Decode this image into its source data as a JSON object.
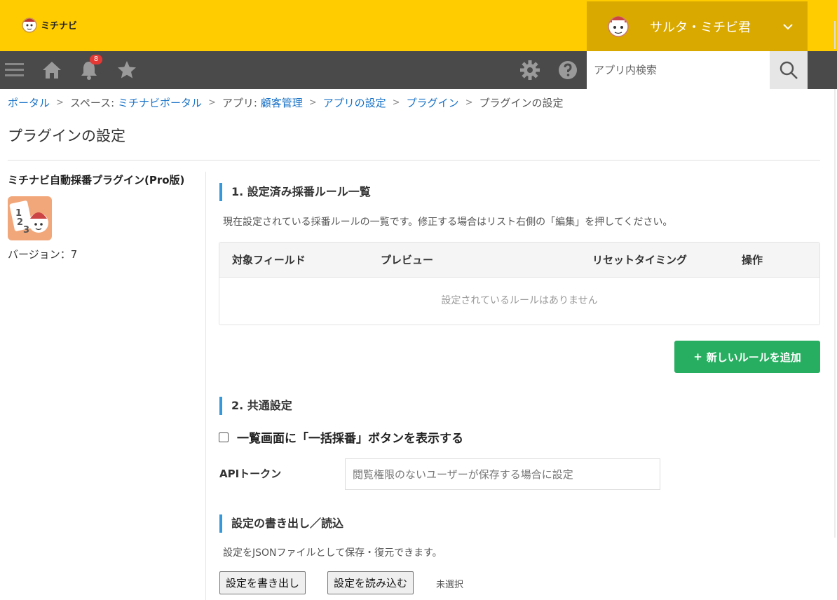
{
  "header": {
    "logo_text": "ミチナビ",
    "user_name": "サルタ・ミチビ君"
  },
  "toolbar": {
    "notification_count": "8",
    "search_placeholder": "アプリ内検索"
  },
  "breadcrumb": {
    "portal": "ポータル",
    "space_prefix": "スペース: ",
    "space": "ミチナビポータル",
    "app_prefix": "アプリ: ",
    "app": "顧客管理",
    "app_settings": "アプリの設定",
    "plugins": "プラグイン",
    "current": "プラグインの設定",
    "separator": ">"
  },
  "page": {
    "title": "プラグインの設定"
  },
  "plugin": {
    "name": "ミチナビ自動採番プラグイン(Pro版)",
    "version": "バージョン：7"
  },
  "section1": {
    "heading": "1. 設定済み採番ルール一覧",
    "description": "現在設定されている採番ルールの一覧です。修正する場合はリスト右側の「編集」を押してください。",
    "columns": [
      "対象フィールド",
      "プレビュー",
      "リセットタイミング",
      "操作"
    ],
    "empty_message": "設定されているルールはありません",
    "add_button": "新しいルールを追加",
    "add_button_icon": "+"
  },
  "section2": {
    "heading": "2. 共通設定",
    "checkbox_label": "一覧画面に「一括採番」ボタンを表示する",
    "checkbox_checked": false,
    "api_label": "APIトークン",
    "api_placeholder": "閲覧権限のないユーザーが保存する場合に設定",
    "api_value": ""
  },
  "section3": {
    "heading": "設定の書き出し／読込",
    "description": "設定をJSONファイルとして保存・復元できます。",
    "export_button": "設定を書き出し",
    "import_button": "設定を読み込む",
    "file_status": "未選択"
  },
  "colors": {
    "header_bg": "#ffcc00",
    "user_area_bg": "#d9a900",
    "toolbar_bg": "#4a4a4a",
    "link": "#1a73c7",
    "accent_bar": "#3498db",
    "add_button": "#27ae60",
    "badge": "#e53935"
  },
  "icons": [
    "logo-icon",
    "avatar-icon",
    "chevron-down-icon",
    "menu-icon",
    "home-icon",
    "bell-icon",
    "star-icon",
    "gear-icon",
    "help-icon",
    "search-icon",
    "plugin-icon"
  ]
}
